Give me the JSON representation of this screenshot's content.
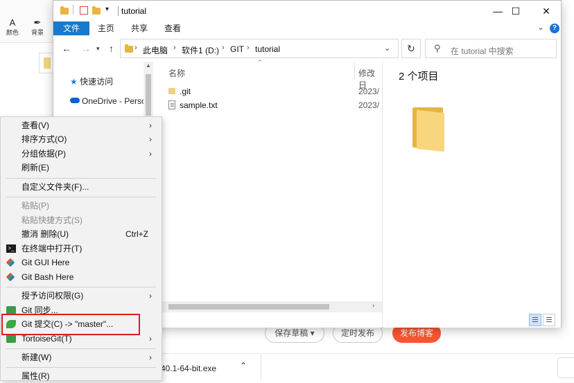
{
  "background_app": {
    "toolbar": [
      {
        "glyph": "A",
        "label": "颜色"
      },
      {
        "glyph": "✒",
        "label": "背景"
      }
    ],
    "buttons": {
      "save_draft": "保存草稿",
      "schedule": "定时发布",
      "publish": "发布博客"
    },
    "download": {
      "filename": "40.1-64-bit.exe"
    }
  },
  "explorer": {
    "title": "tutorial",
    "window_controls": {
      "minimize": "—",
      "maximize": "☐",
      "close": "✕"
    },
    "ribbon_tabs": [
      "文件",
      "主页",
      "共享",
      "查看"
    ],
    "address": {
      "crumbs": [
        "此电脑",
        "软件1 (D:)",
        "GIT",
        "tutorial"
      ],
      "search_placeholder": "在 tutorial 中搜索"
    },
    "nav_items": [
      {
        "label": "快速访问",
        "icon": "star-icon"
      },
      {
        "label": "OneDrive - Perso",
        "icon": "cloud-icon"
      }
    ],
    "columns": {
      "name": "名称",
      "modified": "修改日"
    },
    "files": [
      {
        "name": ".git",
        "date": "2023/",
        "icon": "folder-icon"
      },
      {
        "name": "sample.txt",
        "date": "2023/",
        "icon": "text-file-icon"
      }
    ],
    "preview": {
      "count_text": "2 个项目"
    }
  },
  "context_menu": {
    "items": [
      {
        "label": "查看(V)",
        "submenu": true
      },
      {
        "label": "排序方式(O)",
        "submenu": true
      },
      {
        "label": "分组依据(P)",
        "submenu": true
      },
      {
        "label": "刷新(E)"
      },
      {
        "label": "自定义文件夹(F)..."
      },
      {
        "label": "粘贴(P)",
        "disabled": true
      },
      {
        "label": "粘贴快捷方式(S)",
        "disabled": true
      },
      {
        "label": "撤消 删除(U)",
        "shortcut": "Ctrl+Z"
      },
      {
        "label": "在终端中打开(T)",
        "icon": "terminal-icon"
      },
      {
        "label": "Git GUI Here",
        "icon": "git-gui-icon"
      },
      {
        "label": "Git Bash Here",
        "icon": "git-bash-icon"
      },
      {
        "label": "授予访问权限(G)",
        "submenu": true
      },
      {
        "label": "Git 同步...",
        "icon": "git-sync-icon"
      },
      {
        "label": "Git 提交(C) -> \"master\"...",
        "icon": "git-commit-icon",
        "highlighted": true
      },
      {
        "label": "TortoiseGit(T)",
        "icon": "tortoisegit-icon",
        "submenu": true
      },
      {
        "label": "新建(W)",
        "submenu": true
      },
      {
        "label": "属性(R)"
      }
    ]
  },
  "colors": {
    "accent": "#1979ca",
    "publish": "#fc5531",
    "highlight_border": "#e01b1b"
  }
}
